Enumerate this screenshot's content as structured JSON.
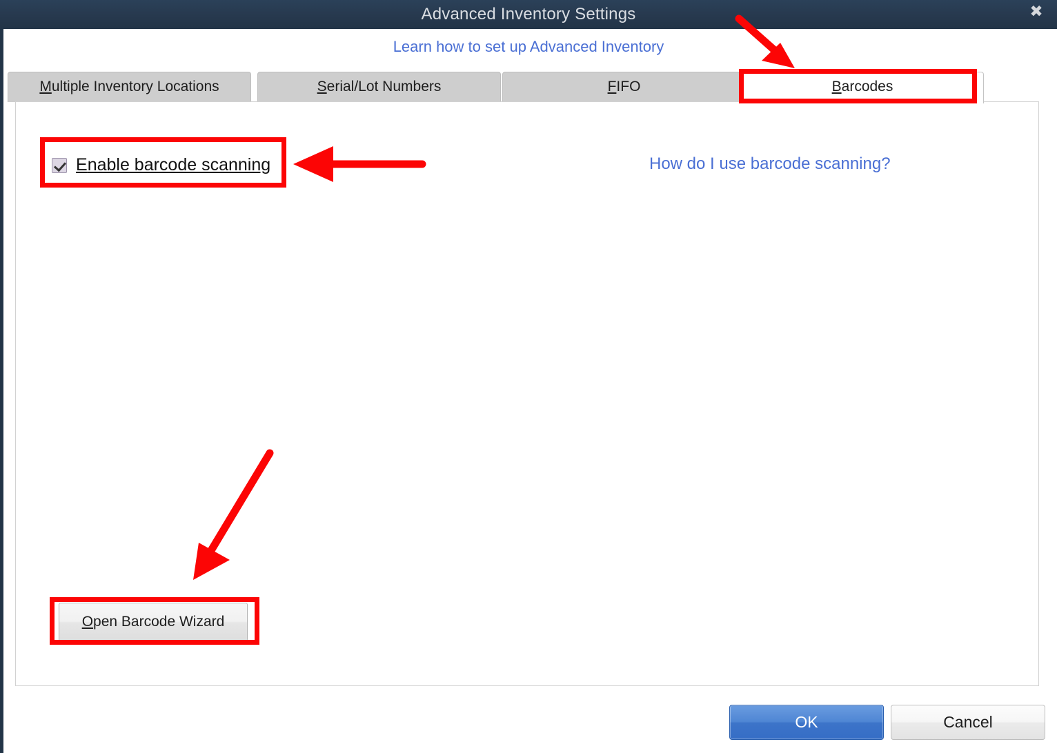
{
  "window": {
    "title": "Advanced Inventory Settings",
    "close_icon": "close-icon",
    "close_glyph": "✖"
  },
  "header": {
    "learn_link": "Learn how to set up Advanced Inventory"
  },
  "tabs": [
    {
      "label": "Multiple Inventory Locations",
      "accel": "M",
      "rest": "ultiple Inventory Locations",
      "active": false
    },
    {
      "label": "Serial/Lot Numbers",
      "accel": "S",
      "rest": "erial/Lot Numbers",
      "active": false
    },
    {
      "label": "FIFO",
      "accel": "F",
      "rest": "IFO",
      "active": false
    },
    {
      "label": "Barcodes",
      "accel": "B",
      "rest": "arcodes",
      "active": true
    }
  ],
  "barcodes_panel": {
    "enable_checkbox_label": "Enable barcode scanning",
    "enable_checkbox_accel": "E",
    "enable_checkbox_checked": "true",
    "help_link": "How do I use barcode scanning?",
    "wizard_button_accel": "O",
    "wizard_button_rest": "pen Barcode Wizard",
    "wizard_button_label": "Open Barcode Wizard"
  },
  "footer": {
    "ok_label": "OK",
    "cancel_label": "Cancel"
  },
  "colors": {
    "titlebar": "#27394e",
    "link": "#4a6fd4",
    "tab_inactive": "#cecece",
    "tab_active": "#ffffff",
    "ok_button": "#4f86d4",
    "annotation_red": "#fc0505"
  },
  "annotations": {
    "arrow_to_barcodes_tab": "red-arrow",
    "arrow_to_enable_checkbox": "red-arrow",
    "arrow_to_wizard_button": "red-arrow",
    "box_barcodes_tab": "red-highlight-box",
    "box_enable_checkbox": "red-highlight-box",
    "box_wizard_button": "red-highlight-box"
  }
}
